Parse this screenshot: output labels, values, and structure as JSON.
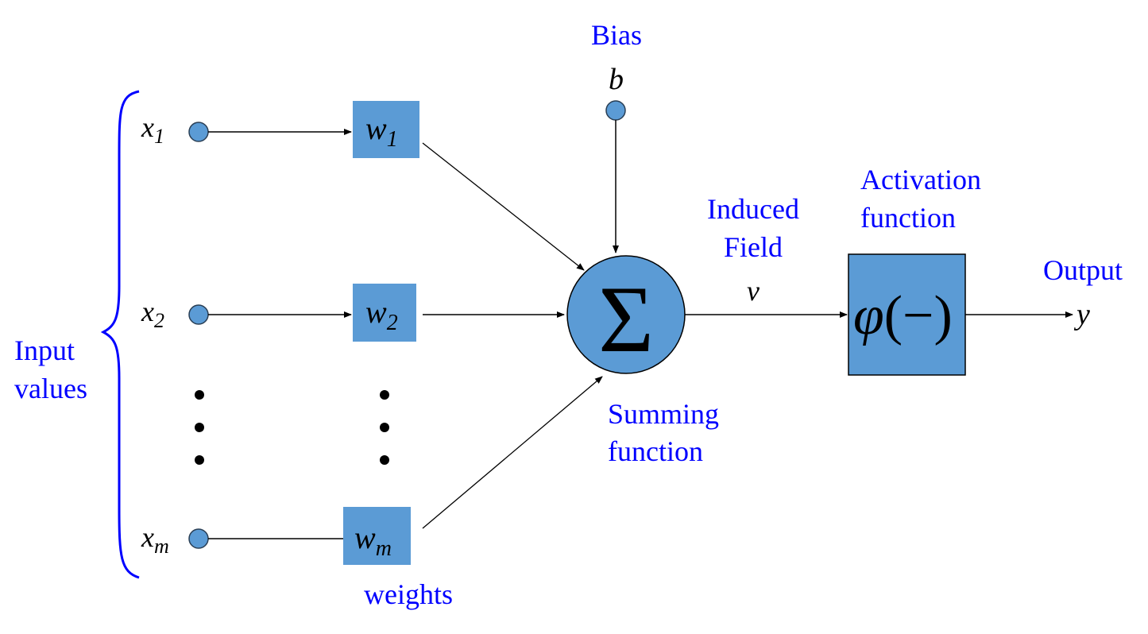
{
  "colors": {
    "node_fill": "#5b9bd5",
    "label_blue": "#0000ff",
    "line": "#000000"
  },
  "labels": {
    "bias": "Bias",
    "input_values_line1": "Input",
    "input_values_line2": "values",
    "weights": "weights",
    "induced_field_line1": "Induced",
    "induced_field_line2": "Field",
    "summing_line1": "Summing",
    "summing_line2": "function",
    "activation_line1": "Activation",
    "activation_line2": "function",
    "output": "Output"
  },
  "symbols": {
    "bias": "b",
    "induced": "v",
    "output": "y",
    "sum": "Σ",
    "activation_phi": "φ",
    "activation_arg": "(−)"
  },
  "inputs": [
    {
      "base": "x",
      "sub": "1"
    },
    {
      "base": "x",
      "sub": "2"
    },
    {
      "base": "x",
      "sub": "m"
    }
  ],
  "weights": [
    {
      "base": "w",
      "sub": "1"
    },
    {
      "base": "w",
      "sub": "2"
    },
    {
      "base": "w",
      "sub": "m"
    }
  ]
}
